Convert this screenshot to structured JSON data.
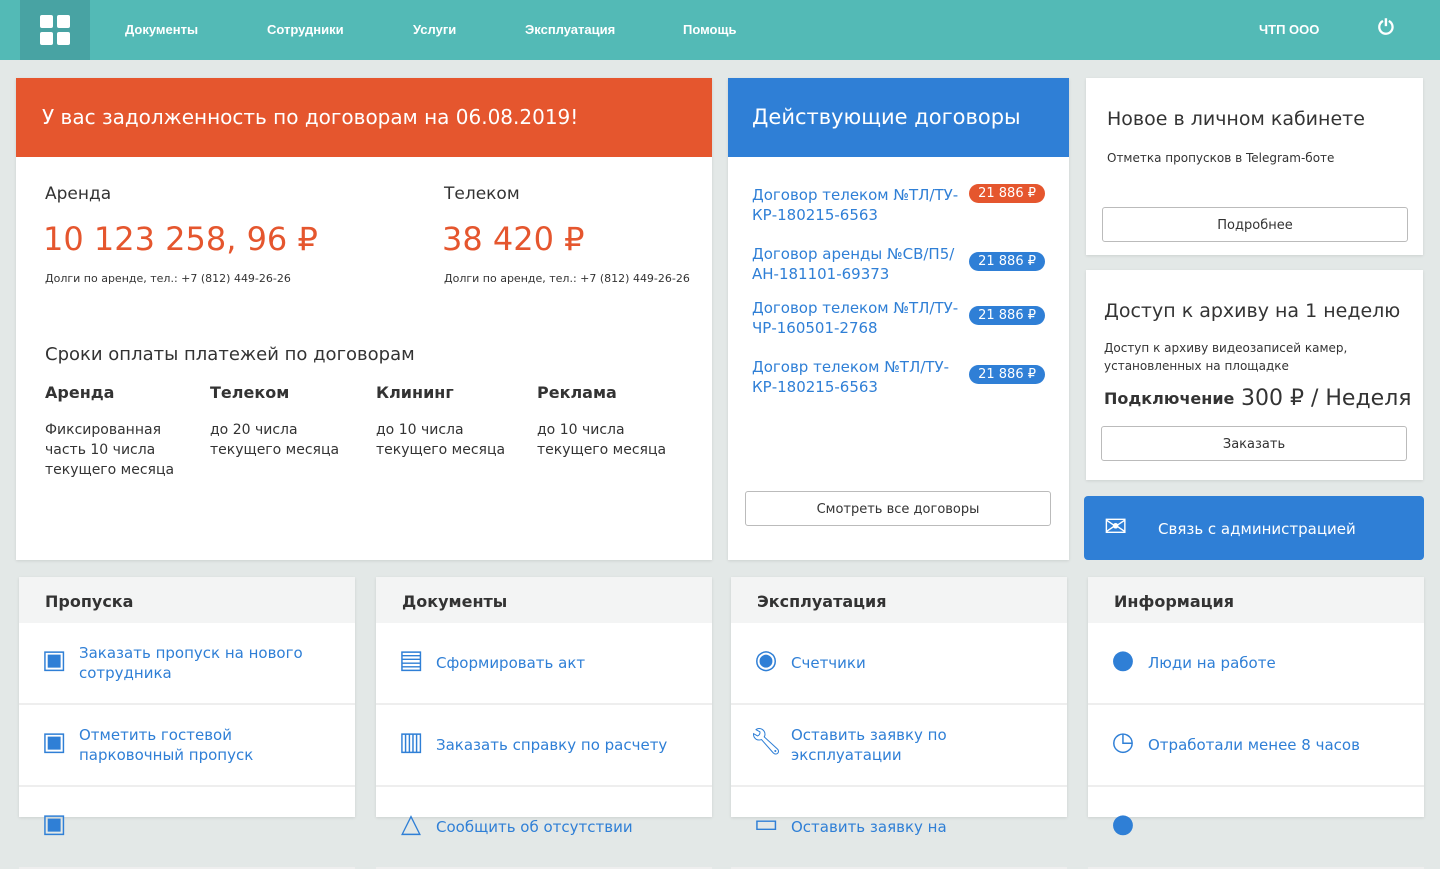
{
  "nav": {
    "items": [
      "Документы",
      "Сотрудники",
      "Услуги",
      "Эксплуатация",
      "Помощь"
    ],
    "company": "ЧТП ООО"
  },
  "debt": {
    "title": "У вас задолженность по договорам на 06.08.2019!",
    "blocks": [
      {
        "label": "Аренда",
        "amount": "10 123 258, 96 ₽",
        "note": "Долги по аренде, тел.: +7 (812) 449-26-26"
      },
      {
        "label": "Телеком",
        "amount": "38 420 ₽",
        "note": "Долги по аренде, тел.: +7 (812) 449-26-26"
      }
    ],
    "terms_title": "Сроки оплаты платежей по договорам",
    "terms": [
      {
        "label": "Аренда",
        "text": "Фиксированная часть 10 числа текущего месяца"
      },
      {
        "label": "Телеком",
        "text": "до 20 числа текущего месяца"
      },
      {
        "label": "Клининг",
        "text": "до 10 числа текущего месяца"
      },
      {
        "label": "Реклама",
        "text": "до 10 числа текущего месяца"
      }
    ]
  },
  "contracts": {
    "title": "Действующие договоры",
    "items": [
      {
        "name": "Договор телеком №ТЛ/ТУ-КР-180215-6563",
        "amount": "21 886 ₽",
        "status": "overdue"
      },
      {
        "name": "Договор аренды №СВ/П5/АН-181101-69373",
        "amount": "21 886 ₽",
        "status": "ok"
      },
      {
        "name": "Договор телеком №ТЛ/ТУ-ЧР-160501-2768",
        "amount": "21 886 ₽",
        "status": "ok"
      },
      {
        "name": "Договр телеком №ТЛ/ТУ-КР-180215-6563",
        "amount": "21 886 ₽",
        "status": "ok"
      }
    ],
    "all_button": "Смотреть все договоры"
  },
  "news": {
    "title": "Новое в личном кабинете",
    "text": "Отметка пропусков в Telegram-боте",
    "button": "Подробнее"
  },
  "archive": {
    "title": "Доступ к архиву на 1 неделю",
    "text": "Доступ к архиву видеозаписей камер, установленных на площадке",
    "price_label": "Подключение",
    "price": "300 ₽ / Неделя",
    "button": "Заказать"
  },
  "contact": {
    "label": "Связь с администрацией"
  },
  "colors": {
    "teal": "#53bab6",
    "orange": "#e5562e",
    "blue": "#2f7fd6"
  },
  "sections": [
    {
      "title": "Пропуска",
      "items": [
        {
          "icon": "badge-icon",
          "text": "Заказать пропуск на нового сотрудника"
        },
        {
          "icon": "badge-user-icon",
          "text": "Отметить гостевой парковочный пропуск"
        },
        {
          "icon": "badge-icon",
          "text": ""
        }
      ]
    },
    {
      "title": "Документы",
      "items": [
        {
          "icon": "document-icon",
          "text": "Сформировать акт"
        },
        {
          "icon": "clipboard-icon",
          "text": "Заказать справку по расчету"
        },
        {
          "icon": "warning-icon",
          "text": "Сообщить об отсутствии"
        }
      ]
    },
    {
      "title": "Эксплуатация",
      "items": [
        {
          "icon": "meter-icon",
          "text": "Счетчики"
        },
        {
          "icon": "wrench-icon",
          "text": "Оставить заявку по эксплуатации"
        },
        {
          "icon": "monitor-icon",
          "text": "Оставить заявку на"
        }
      ]
    },
    {
      "title": "Информация",
      "items": [
        {
          "icon": "person-icon",
          "text": "Люди на работе"
        },
        {
          "icon": "clock-icon",
          "text": "Отработали менее 8 часов"
        },
        {
          "icon": "person-icon",
          "text": ""
        }
      ]
    }
  ]
}
